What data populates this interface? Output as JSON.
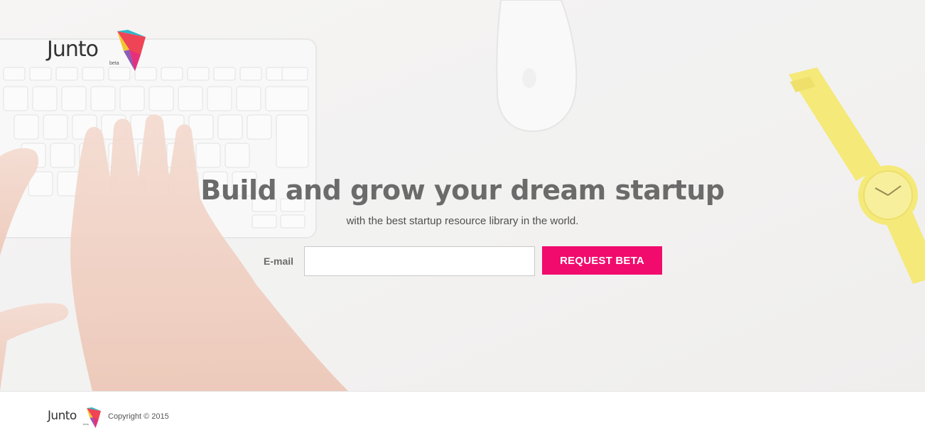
{
  "brand": {
    "name": "Junto",
    "tag": "beta"
  },
  "hero": {
    "headline": "Build and grow your dream startup",
    "subheadline": "with the best startup resource library in the world.",
    "email_label": "E-mail",
    "email_value": "",
    "email_placeholder": "",
    "cta_label": "REQUEST BETA",
    "background_icons": [
      "keyboard",
      "hands",
      "mouse",
      "wristwatch"
    ]
  },
  "footer": {
    "copyright": "Copyright © 2015"
  },
  "colors": {
    "accent": "#f10b6d",
    "logo_red": "#ef4456",
    "logo_pink": "#e6317a",
    "logo_purple": "#8c5ab8",
    "logo_teal": "#2fb5c9",
    "logo_yellow": "#f4c430",
    "headline": "#6b6b6b",
    "watch_yellow": "#f3e45c"
  }
}
